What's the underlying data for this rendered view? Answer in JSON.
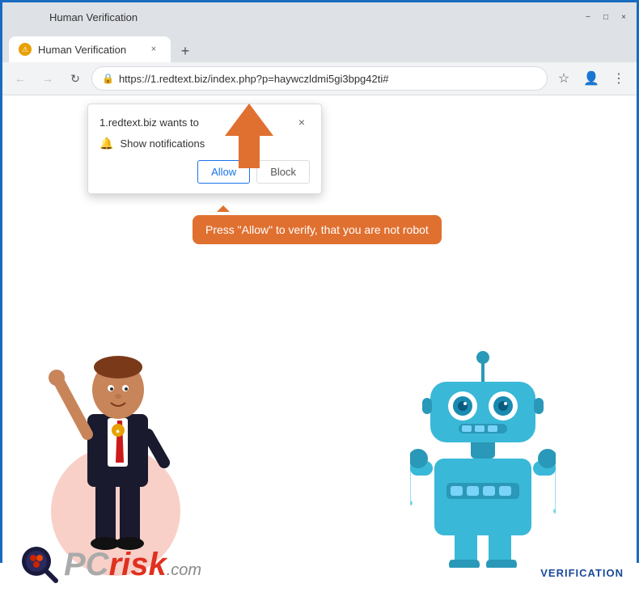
{
  "browser": {
    "title": "Human Verification",
    "url": "https://1.redtext.biz/index.php?p=haywczldmi5gi3bpg42ti#",
    "new_tab_label": "+",
    "tab_close": "×",
    "nav": {
      "back": "←",
      "forward": "→",
      "refresh": "↻"
    },
    "controls": {
      "minimize": "−",
      "maximize": "□",
      "close": "×"
    },
    "star": "☆",
    "account": "👤",
    "menu": "⋮"
  },
  "popup": {
    "title": "1.redtext.biz wants to",
    "notification_label": "Show notifications",
    "close": "×",
    "allow_button": "Allow",
    "block_button": "Block"
  },
  "speech_bubble": {
    "text": "Press \"Allow\" to verify, that you are not robot"
  },
  "pcrisk": {
    "text": "PCrisk.com",
    "pc": "PC",
    "risk": "risk",
    "com": ".com"
  },
  "verification": {
    "label": "VERIFICATION"
  },
  "colors": {
    "blue_border": "#1a6bbf",
    "orange_arrow": "#e07030",
    "allow_button": "#1a73e8",
    "pcrisk_red": "#e03020"
  }
}
